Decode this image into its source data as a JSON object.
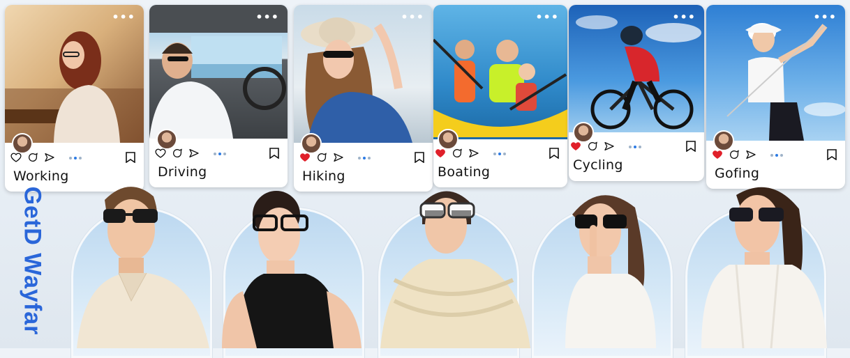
{
  "brand": {
    "name": "GetD Wayfar"
  },
  "cards": [
    {
      "label": "Working",
      "liked": false
    },
    {
      "label": "Driving",
      "liked": false
    },
    {
      "label": "Hiking",
      "liked": true
    },
    {
      "label": "Boating",
      "liked": true
    },
    {
      "label": "Cycling",
      "liked": true
    },
    {
      "label": "Gofing",
      "liked": true
    }
  ],
  "icons": {
    "more": "more-dots-icon",
    "like": "heart-icon",
    "comment": "comment-icon",
    "share": "send-icon",
    "save": "bookmark-icon"
  },
  "colors": {
    "brand": "#2a66d9",
    "like": "#e0202a",
    "pager_active": "#2c7be5"
  }
}
